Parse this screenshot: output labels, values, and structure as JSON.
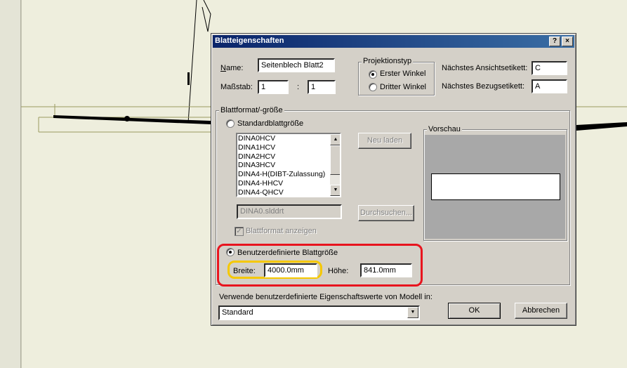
{
  "dialog": {
    "title": "Blatteigenschaften",
    "help_btn": "?",
    "close_btn": "×"
  },
  "name": {
    "label": "Name:",
    "value": "Seitenblech Blatt2"
  },
  "scale": {
    "label": "Maßstab:",
    "num": "1",
    "separator": ":",
    "den": "1"
  },
  "projection": {
    "title": "Projektionstyp",
    "first_angle": "Erster Winkel",
    "third_angle": "Dritter Winkel",
    "selected": "first_angle"
  },
  "next_view_label": {
    "label": "Nächstes Ansichtsetikett:",
    "value": "C"
  },
  "next_datum_label": {
    "label": "Nächstes Bezugsetikett:",
    "value": "A"
  },
  "sheet_format": {
    "title": "Blattformat/-größe",
    "standard_label": "Standardblattgröße",
    "items": [
      "DINA0HCV",
      "DINA1HCV",
      "DINA2HCV",
      "DINA3HCV",
      "DINA4-H(DIBT-Zulassung)",
      "DINA4-HHCV",
      "DINA4-QHCV"
    ],
    "reload_btn": "Neu laden",
    "file_value": "DINA0.slddrt",
    "browse_btn": "Durchsuchen...",
    "show_format_label": "Blattformat anzeigen",
    "show_format_checked": true,
    "custom_label": "Benutzerdefinierte Blattgröße",
    "custom_selected": true,
    "width_label": "Breite:",
    "width_value": "4000.0mm",
    "height_label": "Höhe:",
    "height_value": "841.0mm"
  },
  "preview": {
    "title": "Vorschau"
  },
  "model_props": {
    "label": "Verwende benutzerdefinierte Eigenschaftswerte von Modell in:",
    "value": "Standard"
  },
  "buttons": {
    "ok": "OK",
    "cancel": "Abbrechen"
  },
  "highlight_colors": {
    "red": "#e8141e",
    "yellow": "#f5c800"
  }
}
